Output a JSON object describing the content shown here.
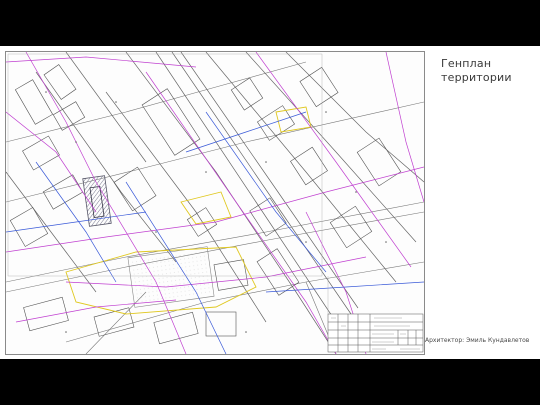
{
  "slide": {
    "title": "Генплан территории",
    "author": "Архитектор: Эмиль Кундавлетов"
  },
  "colors": {
    "background": "#000000",
    "slide": "#ffffff",
    "linework": "#6f6f6f",
    "magenta_lines": "#c040d0",
    "blue_lines": "#3050d8",
    "yellow_zone": "#e8d030",
    "building_hatch": "#9a9aa8"
  },
  "drawing": {
    "type": "site-master-plan",
    "stamp": "title-block"
  }
}
